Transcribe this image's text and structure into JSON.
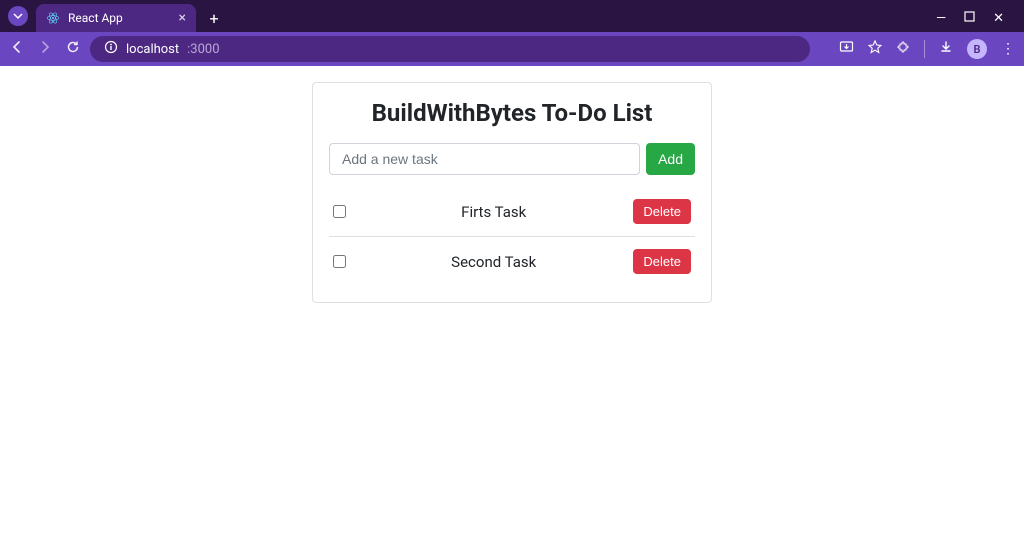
{
  "browser": {
    "tab_title": "React App",
    "url_host": "localhost",
    "url_port": ":3000",
    "profile_letter": "B"
  },
  "app": {
    "title": "BuildWithBytes To-Do List",
    "input_placeholder": "Add a new task",
    "add_label": "Add",
    "delete_label": "Delete",
    "tasks": [
      {
        "label": "Firts Task",
        "checked": false
      },
      {
        "label": "Second Task",
        "checked": false
      }
    ]
  }
}
